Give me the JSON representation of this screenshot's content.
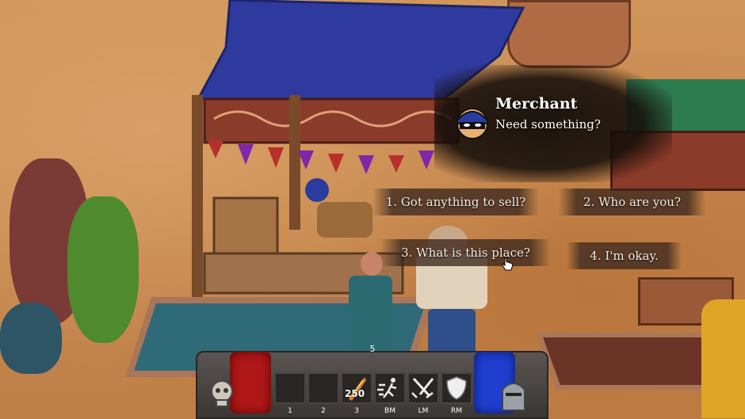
{
  "dialog": {
    "speaker": "Merchant",
    "line": "Need something?",
    "options": [
      "1. Got anything to sell?",
      "2. Who are you?",
      "3. What is this place?",
      "4. I'm okay."
    ]
  },
  "hud": {
    "level": "5",
    "slot3_count": "250",
    "keys": [
      "1",
      "2",
      "3",
      "BM",
      "LM",
      "RM"
    ]
  },
  "colors": {
    "canopy": "#2f3a9e",
    "health_orb": "#b01818",
    "mana_orb": "#1f3fd1",
    "ground": "#c98a4e"
  },
  "icons": [
    "speech-portrait-icon",
    "fire-weapon-icon",
    "dash-icon",
    "crossed-swords-icon",
    "shield-icon",
    "skull-icon",
    "knight-helmet-icon"
  ]
}
